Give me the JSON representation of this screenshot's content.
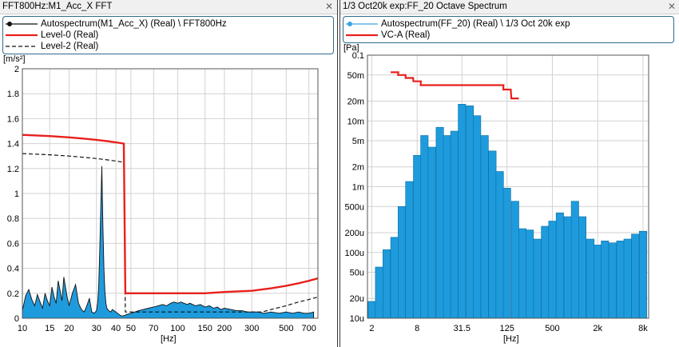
{
  "left_panel": {
    "title": "FFT800Hz:M1_Acc_X FFT",
    "legend": [
      {
        "label": "Autospectrum(M1_Acc_X) (Real) \\ FFT800Hz",
        "color": "#111111",
        "style": "line-dot"
      },
      {
        "label": "Level-0 (Real)",
        "color": "#e8201c",
        "style": "solid"
      },
      {
        "label": "Level-2 (Real)",
        "color": "#111111",
        "style": "dashed"
      }
    ],
    "y_unit": "[m/s²]",
    "x_unit": "[Hz]",
    "y_ticks": [
      {
        "v": 0,
        "label": "0"
      },
      {
        "v": 0.2,
        "label": "0.2"
      },
      {
        "v": 0.4,
        "label": "0.4"
      },
      {
        "v": 0.6,
        "label": "0.6"
      },
      {
        "v": 0.8,
        "label": "0.8"
      },
      {
        "v": 1.0,
        "label": "1"
      },
      {
        "v": 1.2,
        "label": "1.2"
      },
      {
        "v": 1.4,
        "label": "1.4"
      },
      {
        "v": 1.6,
        "label": "1.6"
      },
      {
        "v": 1.8,
        "label": "1.8"
      },
      {
        "v": 2.0,
        "label": "2"
      }
    ],
    "x_ticks": [
      {
        "v": 10,
        "label": "10"
      },
      {
        "v": 15,
        "label": "15"
      },
      {
        "v": 20,
        "label": "20"
      },
      {
        "v": 30,
        "label": "30"
      },
      {
        "v": 40,
        "label": "40"
      },
      {
        "v": 50,
        "label": "50"
      },
      {
        "v": 70,
        "label": "70"
      },
      {
        "v": 100,
        "label": "100"
      },
      {
        "v": 150,
        "label": "150"
      },
      {
        "v": 200,
        "label": "200"
      },
      {
        "v": 300,
        "label": "300"
      },
      {
        "v": 500,
        "label": "500"
      },
      {
        "v": 700,
        "label": "700"
      }
    ]
  },
  "right_panel": {
    "title": "1/3 Oct20k exp:FF_20 Octave Spectrum",
    "legend": [
      {
        "label": "Autospectrum(FF_20) (Real) \\ 1/3 Oct 20k exp",
        "color": "#3aa3e0",
        "style": "line-dot"
      },
      {
        "label": "VC-A (Real)",
        "color": "#e8201c",
        "style": "solid"
      }
    ],
    "y_unit": "[Pa]",
    "x_unit": "[Hz]",
    "y_ticks": [
      {
        "v": 1e-05,
        "label": "10u"
      },
      {
        "v": 2e-05,
        "label": "20u"
      },
      {
        "v": 5e-05,
        "label": "50u"
      },
      {
        "v": 0.0001,
        "label": "100u"
      },
      {
        "v": 0.0002,
        "label": "200u"
      },
      {
        "v": 0.0005,
        "label": "500u"
      },
      {
        "v": 0.001,
        "label": "1m"
      },
      {
        "v": 0.002,
        "label": "2m"
      },
      {
        "v": 0.005,
        "label": "5m"
      },
      {
        "v": 0.01,
        "label": "10m"
      },
      {
        "v": 0.02,
        "label": "20m"
      },
      {
        "v": 0.05,
        "label": "50m"
      },
      {
        "v": 0.1,
        "label": "0.1"
      }
    ],
    "x_ticks": [
      {
        "v": 2,
        "label": "2"
      },
      {
        "v": 8,
        "label": "8"
      },
      {
        "v": 31.5,
        "label": "31.5"
      },
      {
        "v": 125,
        "label": "125"
      },
      {
        "v": 500,
        "label": "500"
      },
      {
        "v": 2000,
        "label": "2k"
      },
      {
        "v": 8000,
        "label": "8k"
      }
    ]
  },
  "chart_data": [
    {
      "type": "area",
      "x_scale": "log",
      "xlim": [
        10,
        800
      ],
      "ylim": [
        0,
        2
      ],
      "grid": true,
      "fill_color": "#1e9bdc",
      "series": [
        {
          "name": "Autospectrum(M1_Acc_X) (Real) \\ FFT800Hz",
          "x": [
            10,
            10.5,
            11,
            11.5,
            12,
            12.5,
            13,
            13.5,
            14,
            14.5,
            15,
            15.5,
            16,
            16.5,
            17,
            17.5,
            18,
            18.5,
            19,
            19.5,
            20,
            21,
            22,
            23,
            24,
            25,
            26,
            27,
            28,
            29,
            30,
            30.5,
            31,
            31.5,
            32,
            32.5,
            33,
            33.5,
            34,
            34.5,
            35,
            36,
            37,
            38,
            39,
            40,
            41,
            42,
            43,
            44,
            45,
            47,
            50,
            53,
            56,
            60,
            65,
            70,
            75,
            80,
            85,
            90,
            95,
            100,
            105,
            110,
            115,
            120,
            130,
            140,
            150,
            160,
            170,
            180,
            190,
            200,
            220,
            240,
            260,
            280,
            300,
            330,
            360,
            400,
            450,
            500,
            550,
            600,
            650,
            700,
            750
          ],
          "y": [
            0.06,
            0.18,
            0.23,
            0.15,
            0.1,
            0.19,
            0.13,
            0.08,
            0.2,
            0.14,
            0.1,
            0.25,
            0.17,
            0.12,
            0.3,
            0.22,
            0.14,
            0.33,
            0.24,
            0.16,
            0.1,
            0.2,
            0.27,
            0.12,
            0.07,
            0.05,
            0.1,
            0.16,
            0.05,
            0.04,
            0.06,
            0.12,
            0.25,
            0.55,
            0.9,
            1.22,
            0.75,
            0.4,
            0.22,
            0.12,
            0.08,
            0.06,
            0.05,
            0.07,
            0.06,
            0.05,
            0.04,
            0.03,
            0.02,
            0.02,
            0.02,
            0.03,
            0.04,
            0.05,
            0.06,
            0.07,
            0.08,
            0.09,
            0.1,
            0.11,
            0.1,
            0.12,
            0.13,
            0.12,
            0.13,
            0.12,
            0.11,
            0.12,
            0.1,
            0.11,
            0.09,
            0.1,
            0.08,
            0.09,
            0.07,
            0.08,
            0.07,
            0.06,
            0.06,
            0.05,
            0.05,
            0.05,
            0.04,
            0.05,
            0.04,
            0.05,
            0.04,
            0.05,
            0.04,
            0.04,
            0.05
          ]
        },
        {
          "name": "Level-0 (Real)",
          "x": [
            10,
            15,
            20,
            25,
            30,
            35,
            40,
            45,
            46,
            50,
            60,
            70,
            80,
            100,
            150,
            200,
            300,
            400,
            500,
            600,
            700,
            800
          ],
          "y": [
            1.47,
            1.46,
            1.45,
            1.44,
            1.43,
            1.42,
            1.41,
            1.4,
            0.2,
            0.2,
            0.2,
            0.2,
            0.2,
            0.2,
            0.2,
            0.21,
            0.22,
            0.24,
            0.26,
            0.28,
            0.3,
            0.32
          ]
        },
        {
          "name": "Level-2 (Real)",
          "x": [
            10,
            15,
            20,
            25,
            30,
            35,
            40,
            45,
            46,
            50,
            70,
            100,
            150,
            200,
            300,
            350,
            400,
            500,
            600,
            700,
            800
          ],
          "y": [
            1.32,
            1.31,
            1.3,
            1.29,
            1.28,
            1.27,
            1.26,
            1.25,
            0.05,
            0.05,
            0.05,
            0.05,
            0.05,
            0.05,
            0.05,
            0.05,
            0.07,
            0.1,
            0.13,
            0.15,
            0.17
          ]
        }
      ]
    },
    {
      "type": "bar",
      "x_scale": "log",
      "y_scale": "log",
      "xlim": [
        1.75,
        9500
      ],
      "ylim": [
        1e-05,
        0.1
      ],
      "grid": true,
      "fill_color": "#1e9bdc",
      "series": [
        {
          "name": "Autospectrum(FF_20) (Real) \\ 1/3 Oct 20k exp",
          "x": [
            2,
            2.5,
            3.15,
            4,
            5,
            6.3,
            8,
            10,
            12.5,
            16,
            20,
            25,
            31.5,
            40,
            50,
            63,
            80,
            100,
            125,
            160,
            200,
            250,
            315,
            400,
            500,
            630,
            800,
            1000,
            1250,
            1600,
            2000,
            2500,
            3150,
            4000,
            5000,
            6300,
            8000
          ],
          "y": [
            1.8e-05,
            6e-05,
            0.00011,
            0.00017,
            0.0005,
            0.0012,
            0.003,
            0.006,
            0.004,
            0.008,
            0.006,
            0.007,
            0.018,
            0.017,
            0.012,
            0.006,
            0.0035,
            0.0017,
            0.00095,
            0.0006,
            0.00023,
            0.00022,
            0.00016,
            0.00025,
            0.0003,
            0.0004,
            0.00035,
            0.0006,
            0.00035,
            0.00016,
            0.00013,
            0.00015,
            0.00014,
            0.00015,
            0.00016,
            0.00019,
            0.00021
          ]
        },
        {
          "name": "VC-A (Real)",
          "type": "step",
          "x": [
            4,
            5,
            6.3,
            8,
            10,
            12.5,
            16,
            20,
            25,
            31.5,
            40,
            50,
            63,
            80,
            100,
            125,
            160
          ],
          "y": [
            0.055,
            0.05,
            0.045,
            0.04,
            0.035,
            0.035,
            0.035,
            0.035,
            0.035,
            0.035,
            0.035,
            0.035,
            0.035,
            0.035,
            0.035,
            0.03,
            0.022
          ]
        }
      ]
    }
  ]
}
